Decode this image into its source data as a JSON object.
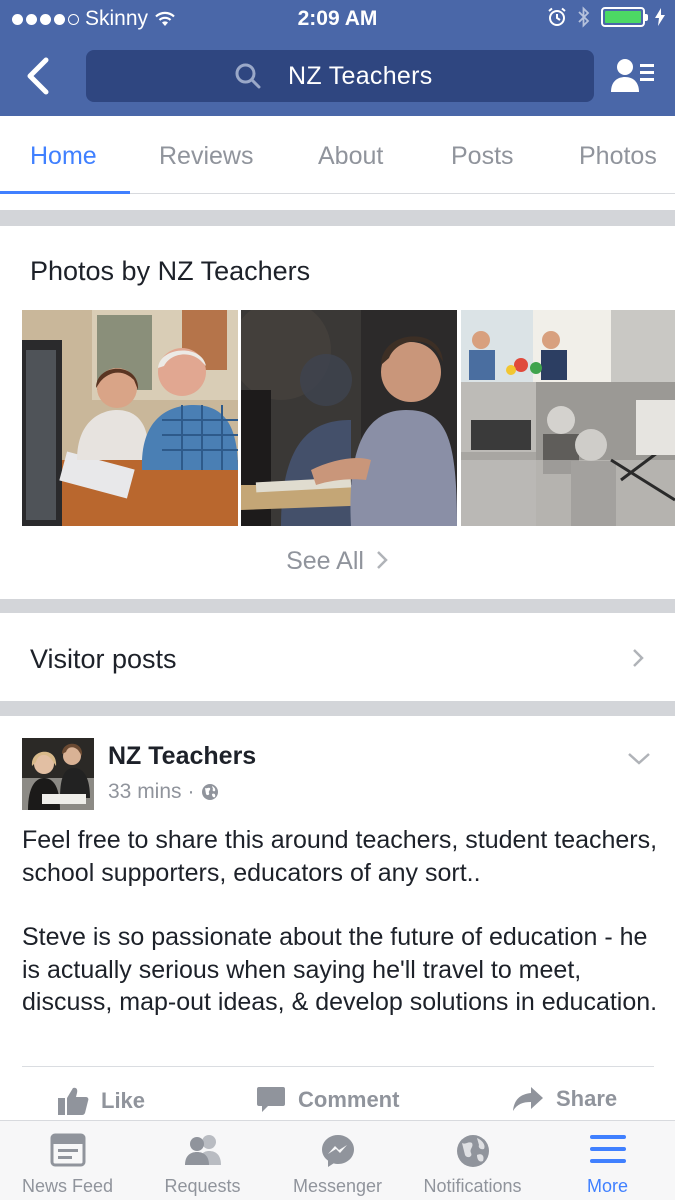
{
  "status_bar": {
    "carrier": "Skinny",
    "time": "2:09 AM"
  },
  "header": {
    "search_query": "NZ Teachers"
  },
  "tabs": [
    {
      "label": "Home",
      "active": true
    },
    {
      "label": "Reviews"
    },
    {
      "label": "About"
    },
    {
      "label": "Posts"
    },
    {
      "label": "Photos"
    }
  ],
  "photos_section": {
    "title": "Photos by NZ Teachers",
    "see_all": "See All"
  },
  "visitor_posts": {
    "label": "Visitor posts"
  },
  "post": {
    "author": "NZ Teachers",
    "time": "33 mins",
    "separator": "·",
    "paragraphs": [
      "Feel free to share this around teachers, student teachers, school supporters, educators of any sort..",
      "Steve is so passionate about the future of education - he is actually serious when saying he'll travel to meet, discuss, map-out ideas, & develop solutions in education."
    ],
    "actions": {
      "like": "Like",
      "comment": "Comment",
      "share": "Share"
    }
  },
  "bottom_nav": [
    {
      "label": "News Feed",
      "icon": "news-feed-icon"
    },
    {
      "label": "Requests",
      "icon": "friend-requests-icon"
    },
    {
      "label": "Messenger",
      "icon": "messenger-icon"
    },
    {
      "label": "Notifications",
      "icon": "globe-icon"
    },
    {
      "label": "More",
      "icon": "menu-icon",
      "active": true
    }
  ],
  "colors": {
    "brand_blue": "#4a67a8",
    "search_bg": "#2f4680",
    "active_blue": "#4080ff",
    "muted": "#90949c"
  }
}
